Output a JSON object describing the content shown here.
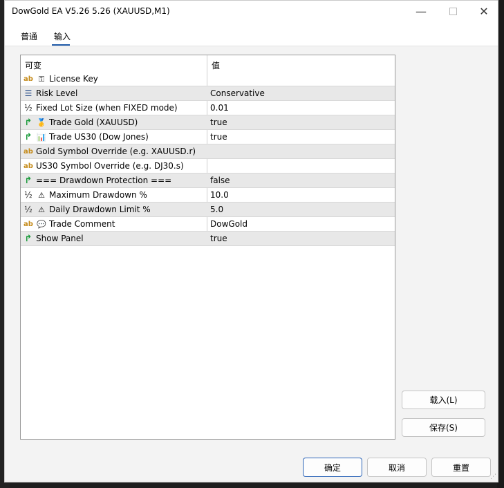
{
  "window": {
    "title": "DowGold EA V5.26 5.26 (XAUUSD,M1)",
    "controls": {
      "minimize": "—",
      "maximize": "",
      "close": "✕"
    }
  },
  "tabs": [
    {
      "label": "普通",
      "active": false
    },
    {
      "label": "输入",
      "active": true
    }
  ],
  "grid": {
    "headers": {
      "variable": "可变",
      "value": "值"
    },
    "rows": [
      {
        "type_icon": "ab",
        "icon": "key-icon",
        "glyph": "⚿",
        "name": "License Key",
        "value": ""
      },
      {
        "type_icon": "☰",
        "icon": "",
        "glyph": "",
        "name": "Risk Level",
        "value": "Conservative"
      },
      {
        "type_icon": "½",
        "icon": "",
        "glyph": "",
        "name": "Fixed Lot Size (when FIXED mode)",
        "value": "0.01"
      },
      {
        "type_icon": "↱",
        "icon": "gold-medal-icon",
        "glyph": "🥇",
        "name": "Trade Gold (XAUUSD)",
        "value": "true"
      },
      {
        "type_icon": "↱",
        "icon": "bar-chart-icon",
        "glyph": "📊",
        "name": "Trade US30 (Dow Jones)",
        "value": "true"
      },
      {
        "type_icon": "ab",
        "icon": "",
        "glyph": "",
        "name": "Gold Symbol Override (e.g. XAUUSD.r)",
        "value": ""
      },
      {
        "type_icon": "ab",
        "icon": "",
        "glyph": "",
        "name": "US30 Symbol Override (e.g. DJ30.s)",
        "value": ""
      },
      {
        "type_icon": "↱",
        "icon": "",
        "glyph": "",
        "name": "=== Drawdown Protection ===",
        "value": "false"
      },
      {
        "type_icon": "½",
        "icon": "warning-icon",
        "glyph": "⚠",
        "name": "Maximum Drawdown %",
        "value": "10.0"
      },
      {
        "type_icon": "½",
        "icon": "warning-icon",
        "glyph": "⚠",
        "name": "Daily Drawdown Limit %",
        "value": "5.0"
      },
      {
        "type_icon": "ab",
        "icon": "speech-bubble-icon",
        "glyph": "💬",
        "name": "Trade Comment",
        "value": "DowGold"
      },
      {
        "type_icon": "↱",
        "icon": "",
        "glyph": "",
        "name": "Show Panel",
        "value": "true"
      }
    ]
  },
  "buttons": {
    "load": "载入(L)",
    "save": "保存(S)",
    "ok": "确定",
    "cancel": "取消",
    "reset": "重置"
  }
}
